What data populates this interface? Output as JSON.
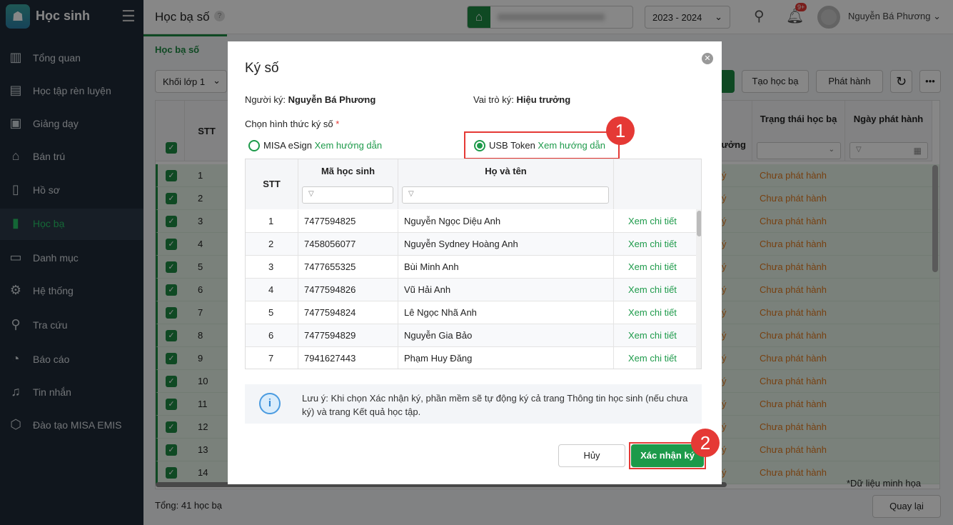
{
  "sidebar": {
    "app_name": "Học sinh",
    "items": [
      {
        "label": "Tổng quan",
        "icon": "bar-chart-icon",
        "glyph": "▥"
      },
      {
        "label": "Học tập rèn luyện",
        "icon": "book-icon",
        "glyph": "▤"
      },
      {
        "label": "Giảng dạy",
        "icon": "board-icon",
        "glyph": "▣"
      },
      {
        "label": "Bán trú",
        "icon": "home-icon",
        "glyph": "⌂"
      },
      {
        "label": "Hồ sơ",
        "icon": "document-icon",
        "glyph": "▯"
      },
      {
        "label": "Học bạ",
        "icon": "record-book-icon",
        "glyph": "▮"
      },
      {
        "label": "Danh mục",
        "icon": "folder-icon",
        "glyph": "▭"
      },
      {
        "label": "Hệ thống",
        "icon": "gear-icon",
        "glyph": "⚙"
      },
      {
        "label": "Tra cứu",
        "icon": "search-icon",
        "glyph": "⚲"
      },
      {
        "label": "Báo cáo",
        "icon": "pie-chart-icon",
        "glyph": "◔"
      },
      {
        "label": "Tin nhắn",
        "icon": "bell-icon",
        "glyph": "♫"
      },
      {
        "label": "Đào tạo MISA EMIS",
        "icon": "cube-icon",
        "glyph": "⬡"
      }
    ],
    "active_index": 5
  },
  "header": {
    "title": "Học bạ số",
    "help": "?",
    "school_year": "2023 - 2024",
    "notification_badge": "9+",
    "user_name": "Nguyễn Bá Phương"
  },
  "tab": "Học bạ số",
  "toolbar": {
    "grade_select": "Khối lớp 1",
    "create_label": "Tạo học bạ",
    "publish_label": "Phát hành"
  },
  "background_table": {
    "headers": {
      "stt": "STT",
      "partial": "ưởng",
      "status": "Trạng thái học bạ",
      "publish_date": "Ngày phát hành"
    },
    "rows": [
      1,
      2,
      3,
      4,
      5,
      6,
      7,
      8,
      9,
      10,
      11,
      12,
      13,
      14
    ],
    "partial_cell": "ý",
    "status_value": "Chưa phát hành",
    "watermark": "*Dữ liệu minh họa"
  },
  "footer": {
    "total": "Tổng: 41 học bạ",
    "back_label": "Quay lại"
  },
  "modal": {
    "title": "Ký số",
    "signer_label": "Người ký:",
    "signer": "Nguyễn Bá Phương",
    "role_label": "Vai trò ký:",
    "role": "Hiệu trưởng",
    "method_label": "Chọn hình thức ký số",
    "required": "*",
    "options": [
      {
        "label": "MISA eSign",
        "link": "Xem hướng dẫn",
        "selected": false
      },
      {
        "label": "USB Token",
        "link": "Xem hướng dẫn",
        "selected": true
      }
    ],
    "step1": "1",
    "step2": "2",
    "table": {
      "headers": [
        "STT",
        "Mã học sinh",
        "Họ và tên"
      ],
      "rows": [
        {
          "stt": "1",
          "code": "7477594825",
          "name": "Nguyễn Ngọc Diệu Anh",
          "action": "Xem chi tiết"
        },
        {
          "stt": "2",
          "code": "7458056077",
          "name": "Nguyễn Sydney Hoàng Anh",
          "action": "Xem chi tiết"
        },
        {
          "stt": "3",
          "code": "7477655325",
          "name": "Bùi Minh Anh",
          "action": "Xem chi tiết"
        },
        {
          "stt": "4",
          "code": "7477594826",
          "name": "Vũ Hải Anh",
          "action": "Xem chi tiết"
        },
        {
          "stt": "5",
          "code": "7477594824",
          "name": "Lê Ngọc Nhã Anh",
          "action": "Xem chi tiết"
        },
        {
          "stt": "6",
          "code": "7477594829",
          "name": "Nguyễn Gia Bảo",
          "action": "Xem chi tiết"
        },
        {
          "stt": "7",
          "code": "7941627443",
          "name": "Phạm Huy Đăng",
          "action": "Xem chi tiết"
        }
      ]
    },
    "note": "Lưu ý: Khi chọn Xác nhận ký, phần mềm sẽ tự động ký cả trang Thông tin học sinh (nếu chưa ký) và trang Kết quả học tập.",
    "cancel_label": "Hủy",
    "confirm_label": "Xác nhận ký"
  },
  "colors": {
    "brand_green": "#1d8a43",
    "status_orange": "#e07a1f",
    "highlight_red": "#e53935",
    "sidebar_bg": "#1f2a37"
  }
}
